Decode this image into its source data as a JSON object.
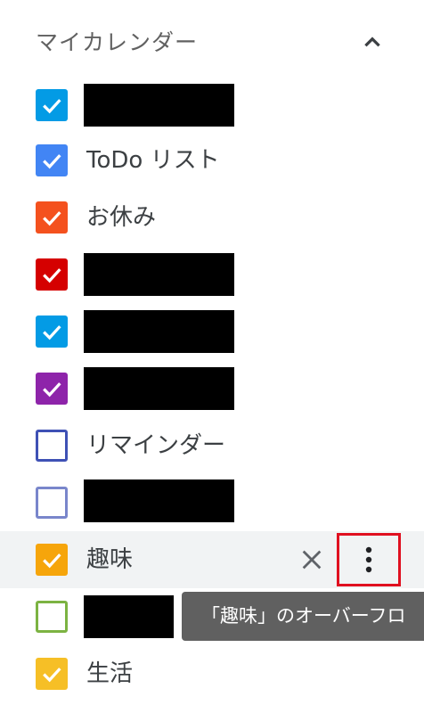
{
  "header": {
    "title": "マイカレンダー",
    "collapse_icon": "chevron-up-icon"
  },
  "calendars": [
    {
      "label": "",
      "checked": true,
      "color": "#039be5",
      "redacted": true
    },
    {
      "label": "ToDo リスト",
      "checked": true,
      "color": "#4285f4",
      "redacted": false
    },
    {
      "label": "お休み",
      "checked": true,
      "color": "#f4511e",
      "redacted": false
    },
    {
      "label": "",
      "checked": true,
      "color": "#d50000",
      "redacted": true
    },
    {
      "label": "",
      "checked": true,
      "color": "#039be5",
      "redacted": true
    },
    {
      "label": "",
      "checked": true,
      "color": "#8e24aa",
      "redacted": true
    },
    {
      "label": "リマインダー",
      "checked": false,
      "color": "#3f51b5",
      "redacted": false
    },
    {
      "label": "",
      "checked": false,
      "color": "#7986cb",
      "redacted": true
    },
    {
      "label": "趣味",
      "checked": true,
      "color": "#f6a50b",
      "redacted": false,
      "hovered": true
    },
    {
      "label": "",
      "checked": false,
      "color": "#7cb342",
      "redacted": true
    },
    {
      "label": "生活",
      "checked": true,
      "color": "#f6bf26",
      "redacted": false
    }
  ],
  "row_actions": {
    "close_icon": "close-icon",
    "more_icon": "more-vert-icon"
  },
  "tooltip": {
    "text": "「趣味」のオーバーフロ"
  }
}
